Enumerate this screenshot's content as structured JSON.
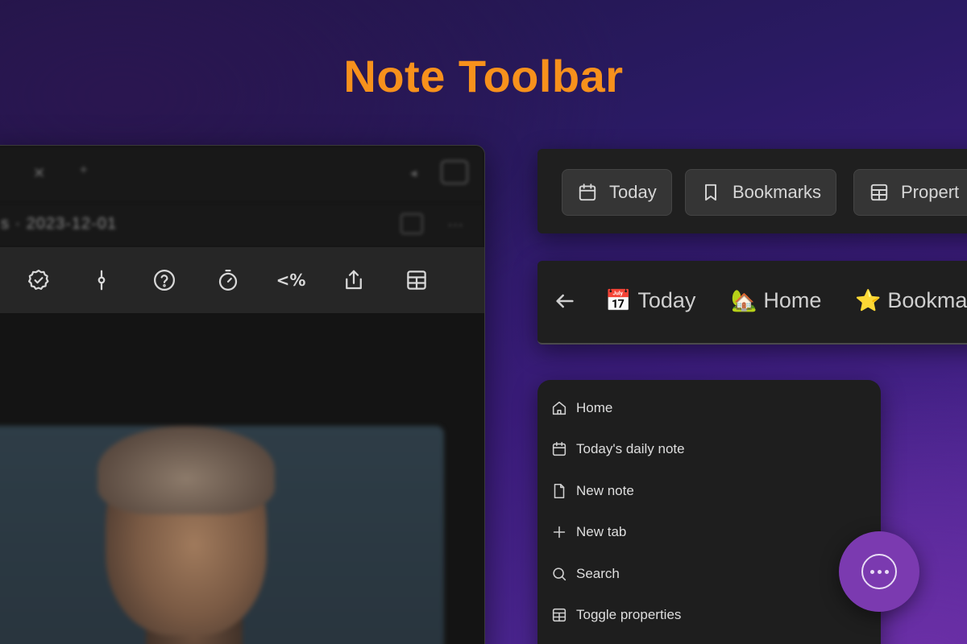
{
  "header": {
    "title": "Note Toolbar"
  },
  "app_window": {
    "breadcrumb": "s · 2023-12-01",
    "toolbar_icons": [
      {
        "name": "badge-check-icon"
      },
      {
        "name": "git-commit-icon"
      },
      {
        "name": "help-circle-icon"
      },
      {
        "name": "timer-icon"
      },
      {
        "name": "template-icon",
        "text": "<%"
      },
      {
        "name": "share-icon"
      },
      {
        "name": "table-icon"
      }
    ]
  },
  "button_toolbar": {
    "buttons": [
      {
        "label": "Today",
        "icon": "calendar-icon"
      },
      {
        "label": "Bookmarks",
        "icon": "bookmark-icon"
      },
      {
        "label": "Propert",
        "icon": "table-icon"
      }
    ]
  },
  "emoji_toolbar": {
    "items": [
      {
        "emoji": "📅",
        "label": "Today"
      },
      {
        "emoji": "🏡",
        "label": "Home"
      },
      {
        "emoji": "⭐",
        "label": "Bookma"
      }
    ]
  },
  "menu": {
    "items": [
      {
        "label": "Home",
        "icon": "home-icon"
      },
      {
        "label": "Today's daily note",
        "icon": "calendar-icon"
      },
      {
        "label": "New note",
        "icon": "file-icon"
      },
      {
        "label": "New tab",
        "icon": "plus-icon"
      },
      {
        "label": "Search",
        "icon": "search-icon"
      },
      {
        "label": "Toggle properties",
        "icon": "table-icon"
      }
    ]
  },
  "colors": {
    "title": "#f7911c",
    "fab": "#7b3ab0",
    "panel": "#1f1f1f"
  }
}
